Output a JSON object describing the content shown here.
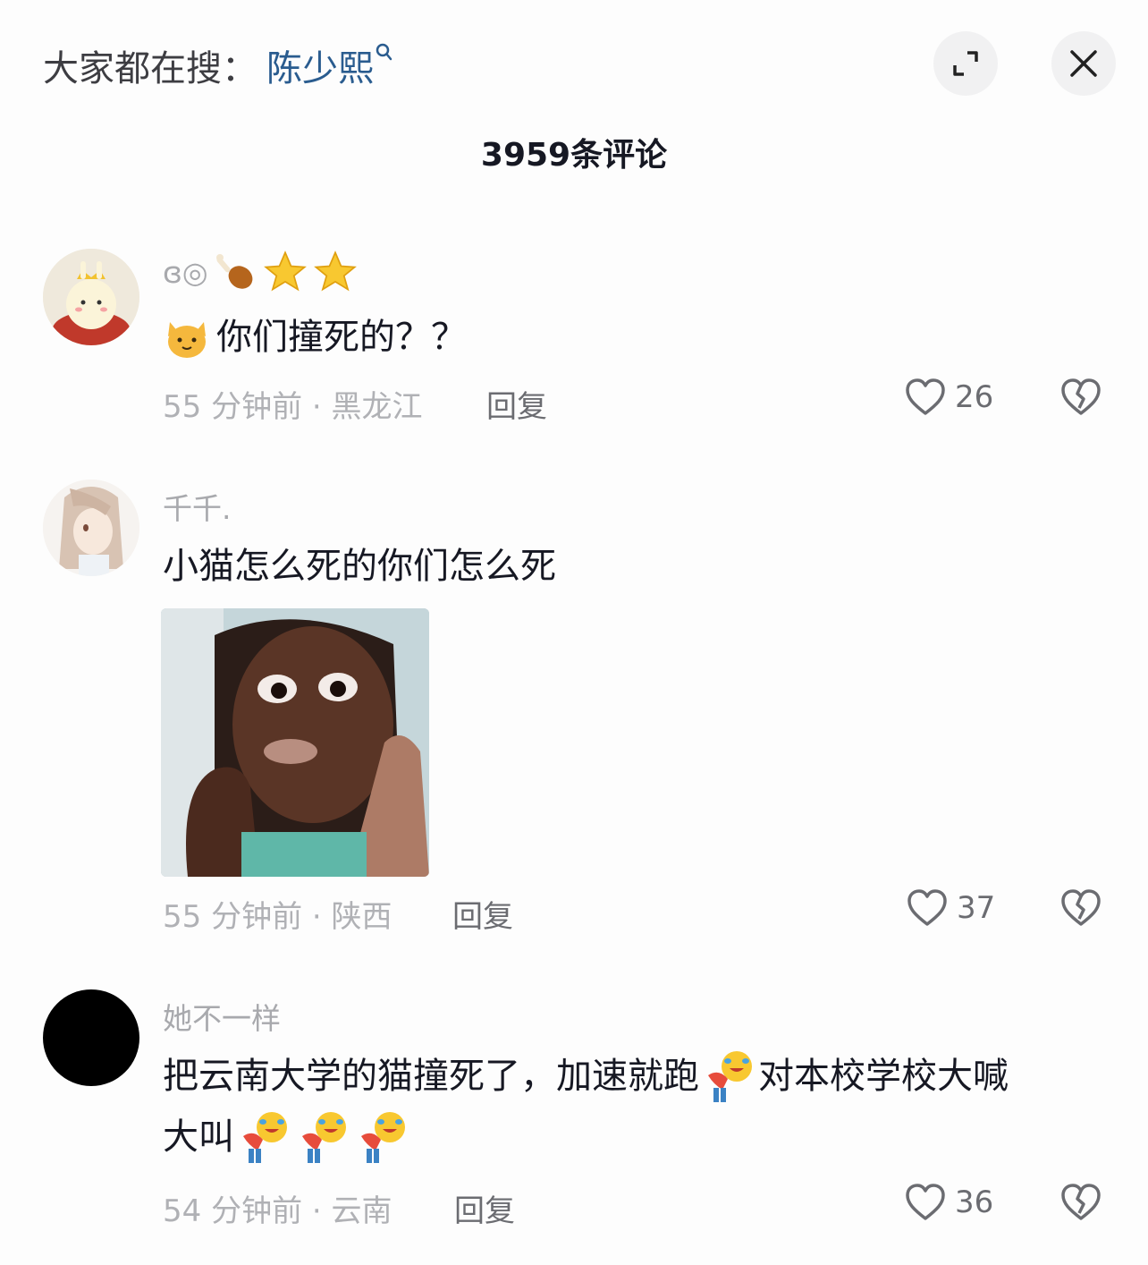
{
  "header": {
    "search_prefix": "大家都在搜：",
    "search_term": "陈少熙",
    "comment_count_title": "3959条评论"
  },
  "comments": [
    {
      "username": "ɞ◎",
      "text": "你们撞死的？？",
      "time_location": "55 分钟前 · 黑龙江",
      "reply_label": "回复",
      "likes": "26"
    },
    {
      "username": "千千.",
      "text": "小猫怎么死的你们怎么死",
      "time_location": "55 分钟前 · 陕西",
      "reply_label": "回复",
      "likes": "37"
    },
    {
      "username": "她不一样",
      "text_line1_a": "把云南大学的猫撞死了，加速就跑",
      "text_line1_b": "对本校学校大喊",
      "text_line2": "大叫",
      "time_location": "54 分钟前 · 云南",
      "reply_label": "回复",
      "likes": "36"
    }
  ],
  "colors": {
    "link": "#2a5c8f",
    "text": "#161823",
    "muted": "#b0b1b5",
    "icon": "#6b6c71"
  }
}
